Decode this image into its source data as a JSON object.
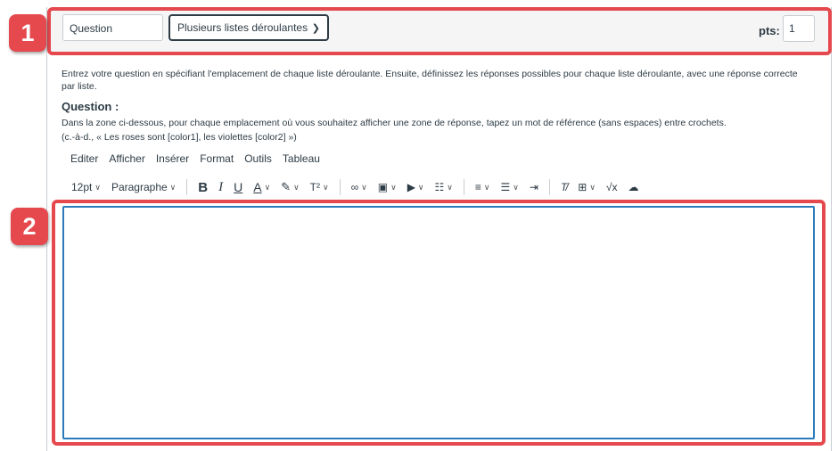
{
  "header": {
    "question_name": "Question",
    "question_type": "Plusieurs listes déroulantes",
    "pts_label": "pts:",
    "pts_value": "1"
  },
  "instructions": {
    "intro": "Entrez votre question en spécifiant l'emplacement de chaque liste déroulante. Ensuite, définissez les réponses possibles pour chaque liste déroulante, avec une réponse correcte par liste.",
    "question_heading": "Question :",
    "help_line1": "Dans la zone ci-dessous, pour chaque emplacement où vous souhaitez afficher une zone de réponse, tapez un mot de référence (sans espaces) entre crochets.",
    "help_line2": "(c.-à-d., « Les roses sont [color1], les violettes [color2] »)"
  },
  "menubar": [
    "Editer",
    "Afficher",
    "Insérer",
    "Format",
    "Outils",
    "Tableau"
  ],
  "toolbar": {
    "font_size": "12pt",
    "block_format": "Paragraphe",
    "bold": "B",
    "italic": "I",
    "underline": "U",
    "text_color": "A",
    "superscript": "T²",
    "math": "√x"
  },
  "callouts": [
    "1",
    "2"
  ],
  "colors": {
    "callout": "#e5484d",
    "editor_focus": "#2b7abc",
    "text": "#2d3b45"
  }
}
